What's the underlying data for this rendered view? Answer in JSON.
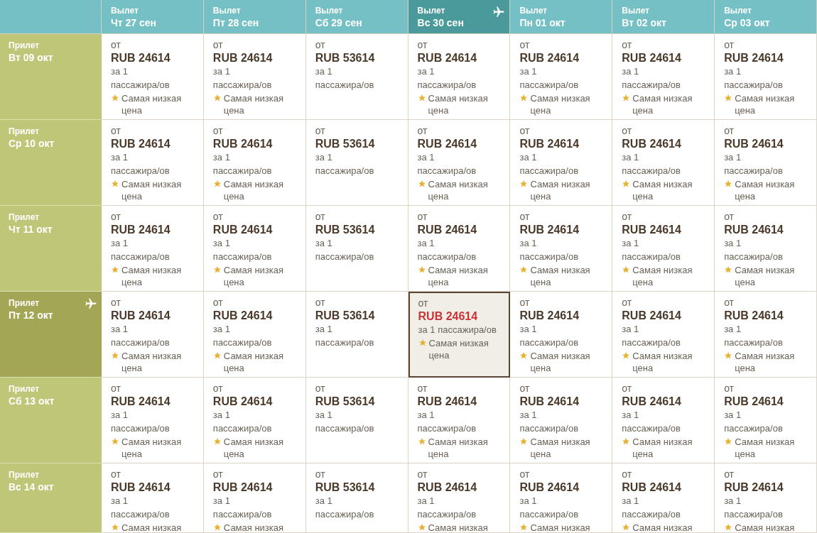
{
  "columns": [
    {
      "label": "Вылет",
      "date": "Чт 27 сен",
      "selected": false
    },
    {
      "label": "Вылет",
      "date": "Пт 28 сен",
      "selected": false
    },
    {
      "label": "Вылет",
      "date": "Сб 29 сен",
      "selected": false
    },
    {
      "label": "Вылет",
      "date": "Вс 30 сен",
      "selected": true
    },
    {
      "label": "Вылет",
      "date": "Пн 01 окт",
      "selected": false
    },
    {
      "label": "Вылет",
      "date": "Вт 02 окт",
      "selected": false
    },
    {
      "label": "Вылет",
      "date": "Ср 03 окт",
      "selected": false
    }
  ],
  "rows": [
    {
      "label": "Прилет",
      "date": "Вт 09 окт",
      "selected": false,
      "cells": [
        {
          "from": "от",
          "price": "RUB 24614",
          "per_lines": [
            "за 1",
            "пассажира/ов"
          ],
          "badge": "Самая низкая цена",
          "selected": false
        },
        {
          "from": "от",
          "price": "RUB 24614",
          "per_lines": [
            "за 1",
            "пассажира/ов"
          ],
          "badge": "Самая низкая цена",
          "selected": false
        },
        {
          "from": "от",
          "price": "RUB 53614",
          "per_lines": [
            "за 1",
            "пассажира/ов"
          ],
          "selected": false
        },
        {
          "from": "от",
          "price": "RUB 24614",
          "per_lines": [
            "за 1",
            "пассажира/ов"
          ],
          "badge": "Самая низкая цена",
          "selected": false
        },
        {
          "from": "от",
          "price": "RUB 24614",
          "per_lines": [
            "за 1",
            "пассажира/ов"
          ],
          "badge": "Самая низкая цена",
          "selected": false
        },
        {
          "from": "от",
          "price": "RUB 24614",
          "per_lines": [
            "за 1",
            "пассажира/ов"
          ],
          "badge": "Самая низкая цена",
          "selected": false
        },
        {
          "from": "от",
          "price": "RUB 24614",
          "per_lines": [
            "за 1",
            "пассажира/ов"
          ],
          "badge": "Самая низкая цена",
          "selected": false
        }
      ]
    },
    {
      "label": "Прилет",
      "date": "Ср 10 окт",
      "selected": false,
      "cells": [
        {
          "from": "от",
          "price": "RUB 24614",
          "per_lines": [
            "за 1",
            "пассажира/ов"
          ],
          "badge": "Самая низкая цена",
          "selected": false
        },
        {
          "from": "от",
          "price": "RUB 24614",
          "per_lines": [
            "за 1",
            "пассажира/ов"
          ],
          "badge": "Самая низкая цена",
          "selected": false
        },
        {
          "from": "от",
          "price": "RUB 53614",
          "per_lines": [
            "за 1",
            "пассажира/ов"
          ],
          "selected": false
        },
        {
          "from": "от",
          "price": "RUB 24614",
          "per_lines": [
            "за 1",
            "пассажира/ов"
          ],
          "badge": "Самая низкая цена",
          "selected": false
        },
        {
          "from": "от",
          "price": "RUB 24614",
          "per_lines": [
            "за 1",
            "пассажира/ов"
          ],
          "badge": "Самая низкая цена",
          "selected": false
        },
        {
          "from": "от",
          "price": "RUB 24614",
          "per_lines": [
            "за 1",
            "пассажира/ов"
          ],
          "badge": "Самая низкая цена",
          "selected": false
        },
        {
          "from": "от",
          "price": "RUB 24614",
          "per_lines": [
            "за 1",
            "пассажира/ов"
          ],
          "badge": "Самая низкая цена",
          "selected": false
        }
      ]
    },
    {
      "label": "Прилет",
      "date": "Чт 11 окт",
      "selected": false,
      "cells": [
        {
          "from": "от",
          "price": "RUB 24614",
          "per_lines": [
            "за 1",
            "пассажира/ов"
          ],
          "badge": "Самая низкая цена",
          "selected": false
        },
        {
          "from": "от",
          "price": "RUB 24614",
          "per_lines": [
            "за 1",
            "пассажира/ов"
          ],
          "badge": "Самая низкая цена",
          "selected": false
        },
        {
          "from": "от",
          "price": "RUB 53614",
          "per_lines": [
            "за 1",
            "пассажира/ов"
          ],
          "selected": false
        },
        {
          "from": "от",
          "price": "RUB 24614",
          "per_lines": [
            "за 1",
            "пассажира/ов"
          ],
          "badge": "Самая низкая цена",
          "selected": false
        },
        {
          "from": "от",
          "price": "RUB 24614",
          "per_lines": [
            "за 1",
            "пассажира/ов"
          ],
          "badge": "Самая низкая цена",
          "selected": false
        },
        {
          "from": "от",
          "price": "RUB 24614",
          "per_lines": [
            "за 1",
            "пассажира/ов"
          ],
          "badge": "Самая низкая цена",
          "selected": false
        },
        {
          "from": "от",
          "price": "RUB 24614",
          "per_lines": [
            "за 1",
            "пассажира/ов"
          ],
          "badge": "Самая низкая цена",
          "selected": false
        }
      ]
    },
    {
      "label": "Прилет",
      "date": "Пт 12 окт",
      "selected": true,
      "cells": [
        {
          "from": "от",
          "price": "RUB 24614",
          "per_lines": [
            "за 1",
            "пассажира/ов"
          ],
          "badge": "Самая низкая цена",
          "selected": false
        },
        {
          "from": "от",
          "price": "RUB 24614",
          "per_lines": [
            "за 1",
            "пассажира/ов"
          ],
          "badge": "Самая низкая цена",
          "selected": false
        },
        {
          "from": "от",
          "price": "RUB 53614",
          "per_lines": [
            "за 1",
            "пассажира/ов"
          ],
          "selected": false
        },
        {
          "from": "от",
          "price": "RUB 24614",
          "per_lines": [
            "за 1 пассажира/ов"
          ],
          "badge": "Самая низкая цена",
          "selected": true
        },
        {
          "from": "от",
          "price": "RUB 24614",
          "per_lines": [
            "за 1",
            "пассажира/ов"
          ],
          "badge": "Самая низкая цена",
          "selected": false
        },
        {
          "from": "от",
          "price": "RUB 24614",
          "per_lines": [
            "за 1",
            "пассажира/ов"
          ],
          "badge": "Самая низкая цена",
          "selected": false
        },
        {
          "from": "от",
          "price": "RUB 24614",
          "per_lines": [
            "за 1",
            "пассажира/ов"
          ],
          "badge": "Самая низкая цена",
          "selected": false
        }
      ]
    },
    {
      "label": "Прилет",
      "date": "Сб 13 окт",
      "selected": false,
      "cells": [
        {
          "from": "от",
          "price": "RUB 24614",
          "per_lines": [
            "за 1",
            "пассажира/ов"
          ],
          "badge": "Самая низкая цена",
          "selected": false
        },
        {
          "from": "от",
          "price": "RUB 24614",
          "per_lines": [
            "за 1",
            "пассажира/ов"
          ],
          "badge": "Самая низкая цена",
          "selected": false
        },
        {
          "from": "от",
          "price": "RUB 53614",
          "per_lines": [
            "за 1",
            "пассажира/ов"
          ],
          "selected": false
        },
        {
          "from": "от",
          "price": "RUB 24614",
          "per_lines": [
            "за 1",
            "пассажира/ов"
          ],
          "badge": "Самая низкая цена",
          "selected": false
        },
        {
          "from": "от",
          "price": "RUB 24614",
          "per_lines": [
            "за 1",
            "пассажира/ов"
          ],
          "badge": "Самая низкая цена",
          "selected": false
        },
        {
          "from": "от",
          "price": "RUB 24614",
          "per_lines": [
            "за 1",
            "пассажира/ов"
          ],
          "badge": "Самая низкая цена",
          "selected": false
        },
        {
          "from": "от",
          "price": "RUB 24614",
          "per_lines": [
            "за 1",
            "пассажира/ов"
          ],
          "badge": "Самая низкая цена",
          "selected": false
        }
      ]
    },
    {
      "label": "Прилет",
      "date": "Вс 14 окт",
      "selected": false,
      "cells": [
        {
          "from": "от",
          "price": "RUB 24614",
          "per_lines": [
            "за 1",
            "пассажира/ов"
          ],
          "badge": "Самая низкая",
          "selected": false
        },
        {
          "from": "от",
          "price": "RUB 24614",
          "per_lines": [
            "за 1",
            "пассажира/ов"
          ],
          "badge": "Самая низкая",
          "selected": false
        },
        {
          "from": "от",
          "price": "RUB 53614",
          "per_lines": [
            "за 1",
            "пассажира/ов"
          ],
          "selected": false
        },
        {
          "from": "от",
          "price": "RUB 24614",
          "per_lines": [
            "за 1",
            "пассажира/ов"
          ],
          "badge": "Самая низкая",
          "selected": false
        },
        {
          "from": "от",
          "price": "RUB 24614",
          "per_lines": [
            "за 1",
            "пассажира/ов"
          ],
          "badge": "Самая низкая",
          "selected": false
        },
        {
          "from": "от",
          "price": "RUB 24614",
          "per_lines": [
            "за 1",
            "пассажира/ов"
          ],
          "badge": "Самая низкая",
          "selected": false
        },
        {
          "from": "от",
          "price": "RUB 24614",
          "per_lines": [
            "за 1",
            "пассажира/ов"
          ],
          "badge": "Самая низкая",
          "selected": false
        }
      ]
    }
  ]
}
